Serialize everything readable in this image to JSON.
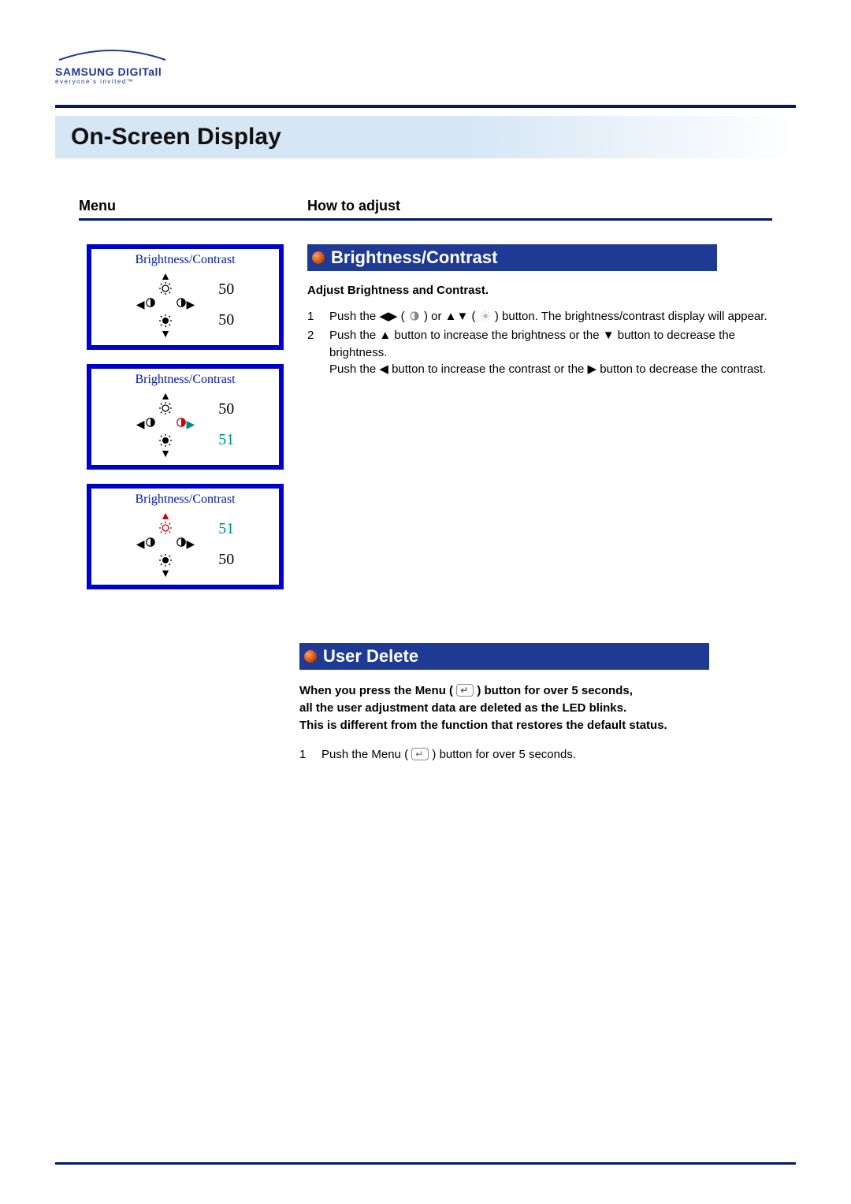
{
  "logo": {
    "brand": "SAMSUNG DIGITall",
    "tagline": "everyone's invited™"
  },
  "page_title": "On-Screen Display",
  "columns": {
    "left_header": "Menu",
    "right_header": "How to adjust"
  },
  "osd_panels": [
    {
      "title": "Brightness/Contrast",
      "top_value": "50",
      "bottom_value": "50",
      "top_class": "val-black",
      "bottom_class": "val-black",
      "top_arrow": "black",
      "bottom_arrow": "black",
      "left_combo": "black",
      "right_combo": "black"
    },
    {
      "title": "Brightness/Contrast",
      "top_value": "50",
      "bottom_value": "51",
      "top_class": "val-black",
      "bottom_class": "val-teal",
      "top_arrow": "black",
      "bottom_arrow": "black",
      "left_combo": "black",
      "right_combo": "teal"
    },
    {
      "title": "Brightness/Contrast",
      "top_value": "51",
      "bottom_value": "50",
      "top_class": "val-teal",
      "bottom_class": "val-black",
      "top_arrow": "red",
      "bottom_arrow": "black",
      "left_combo": "black",
      "right_combo": "black"
    }
  ],
  "section1": {
    "title": "Brightness/Contrast",
    "subtitle": "Adjust Brightness and Contrast.",
    "steps": [
      {
        "num": "1",
        "text_a": "Push the ◀▶ (",
        "text_b": ") or ▲▼ (",
        "text_c": ") button. The brightness/contrast display will appear."
      },
      {
        "num": "2",
        "text_a": "Push the ▲ button to increase the brightness or the ▼ button to decrease the brightness.",
        "text_b": "Push the ◀ button to increase the contrast or the ▶ button to decrease the contrast."
      }
    ]
  },
  "section2": {
    "title": "User Delete",
    "bold_lines": "When you press the Menu ( ⏎ ) button for over 5 seconds,\nall the user adjustment data are deleted as the LED blinks.\nThis is different from the function that restores the default status.",
    "line1a": "When you press the Menu (",
    "line1b": ") button for over 5 seconds,",
    "line2": "all the user adjustment data are deleted as the LED blinks.",
    "line3": "This is different from the function that restores the default status.",
    "steps": [
      {
        "num": "1",
        "text_a": "Push the Menu (",
        "text_b": ") button for over 5 seconds."
      }
    ]
  }
}
